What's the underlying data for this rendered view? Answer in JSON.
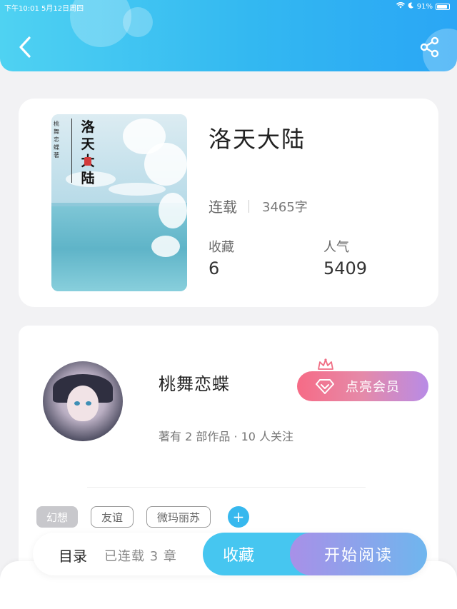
{
  "status_bar": {
    "time_date": "下午10:01   5月12日周四",
    "battery": "91%"
  },
  "colors": {
    "header_start": "#4fd2f2",
    "header_end": "#2aa6f5",
    "accent": "#37b8ee",
    "vip_start": "#f66b86",
    "vip_end": "#b88be6"
  },
  "book": {
    "title": "洛天大陆",
    "cover_title": "洛天大陆",
    "cover_author": "桃舞恋蝶 著",
    "status": "连载",
    "word_count": "3465字",
    "favorites_label": "收藏",
    "favorites_value": "6",
    "popularity_label": "人气",
    "popularity_value": "5409"
  },
  "author": {
    "name": "桃舞恋蝶",
    "meta": "著有 2 部作品 · 10 人关注",
    "vip_button": "点亮会员"
  },
  "tags": [
    "幻想",
    "友谊",
    "微玛丽苏"
  ],
  "add_tag": "+",
  "bottom_bar": {
    "toc_label": "目录",
    "toc_count": "已连载 3 章",
    "collect_label": "收藏",
    "read_label": "开始阅读"
  }
}
